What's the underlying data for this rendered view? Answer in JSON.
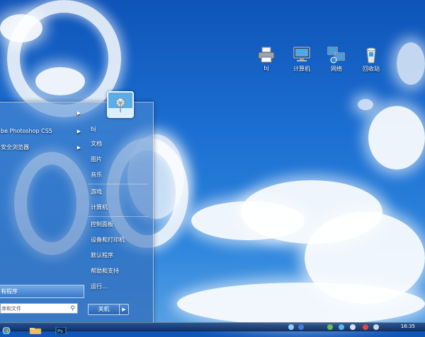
{
  "desktop": {
    "icons": [
      {
        "label": "bj",
        "icon": "printer-icon"
      },
      {
        "label": "计算机",
        "icon": "computer-icon"
      },
      {
        "label": "网络",
        "icon": "network-icon"
      },
      {
        "label": "回收站",
        "icon": "recycle-bin-icon"
      }
    ]
  },
  "start_menu": {
    "programs": [
      {
        "label": "",
        "has_submenu": true
      },
      {
        "label": "be Photoshop CS5",
        "has_submenu": true
      },
      {
        "label": "安全浏览器",
        "has_submenu": true
      }
    ],
    "all_programs_label": "有程序",
    "search_placeholder": "序和文件",
    "right_pane": {
      "user": "bj",
      "items": [
        "文档",
        "图片",
        "音乐",
        "游戏",
        "计算机",
        "控制面板",
        "设备和打印机",
        "默认程序",
        "帮助和支持",
        "运行..."
      ]
    },
    "shutdown_label": "关机"
  },
  "taskbar": {
    "pinned": [
      "start-orb-icon",
      "explorer-folder-icon",
      "photoshop-icon"
    ],
    "clock_time": "16:35"
  },
  "colors": {
    "sky_top": "#0f54b8",
    "sky_bottom": "#5aa2e4",
    "cloud": "#ffffff"
  }
}
